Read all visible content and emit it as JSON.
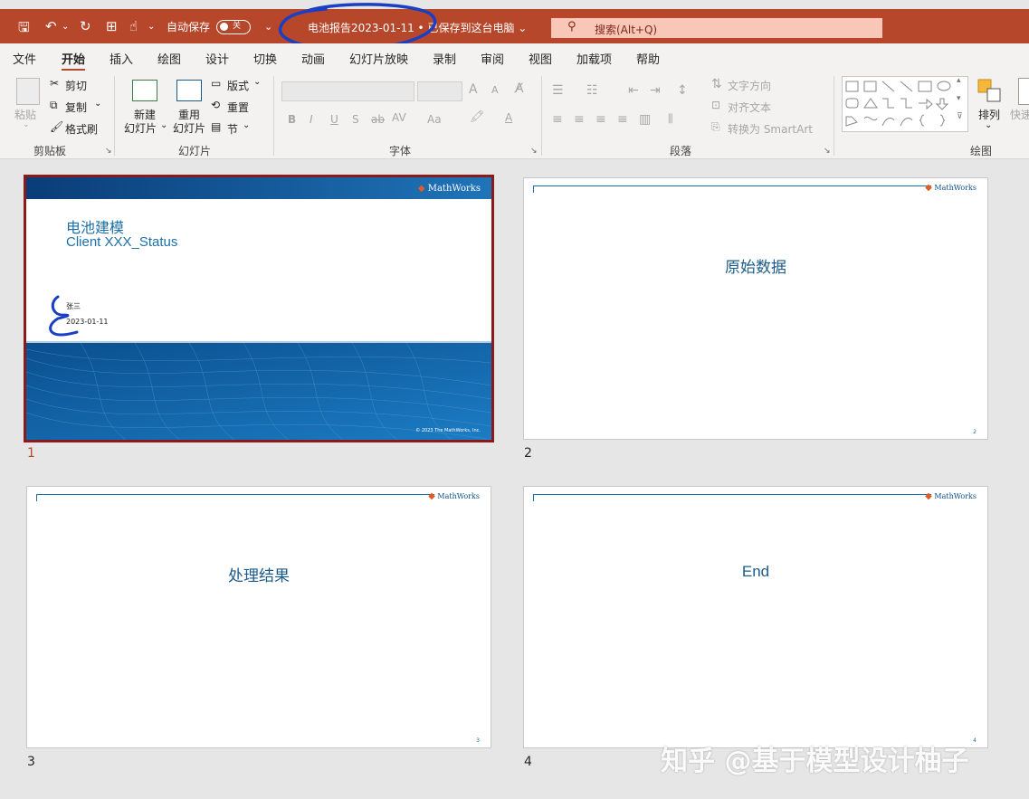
{
  "titlebar": {
    "autosave_label": "自动保存",
    "autosave_state": "关",
    "document_title": "电池报告2023-01-11 • 已保存到这台电脑",
    "search_placeholder": "搜索(Alt+Q)",
    "accent_color": "#b7472a"
  },
  "tabs": [
    {
      "label": "文件"
    },
    {
      "label": "开始",
      "active": true
    },
    {
      "label": "插入"
    },
    {
      "label": "绘图"
    },
    {
      "label": "设计"
    },
    {
      "label": "切换"
    },
    {
      "label": "动画"
    },
    {
      "label": "幻灯片放映"
    },
    {
      "label": "录制"
    },
    {
      "label": "审阅"
    },
    {
      "label": "视图"
    },
    {
      "label": "加载项"
    },
    {
      "label": "帮助"
    }
  ],
  "ribbon": {
    "clipboard": {
      "paste": "粘贴",
      "cut": "剪切",
      "copy": "复制",
      "format_painter": "格式刷",
      "label": "剪贴板"
    },
    "slides": {
      "new_1": "新建",
      "new_2": "幻灯片",
      "reuse_1": "重用",
      "reuse_2": "幻灯片",
      "layout": "版式",
      "reset": "重置",
      "section": "节",
      "label": "幻灯片"
    },
    "font": {
      "label": "字体",
      "bold": "B",
      "italic": "I",
      "underline": "U",
      "shadow": "S",
      "strike": "ab",
      "spacing": "AV",
      "case": "Aa",
      "grow": "A",
      "shrink": "A",
      "font_color": "A"
    },
    "paragraph": {
      "label": "段落",
      "text_direction": "文字方向",
      "align_text": "对齐文本",
      "smartart": "转换为 SmartArt"
    },
    "drawing": {
      "arrange": "排列",
      "quick": "快速",
      "label": "绘图"
    }
  },
  "slides": [
    {
      "num": "1",
      "selected": true,
      "title_line1": "电池建模",
      "title_line2": "Client XXX_Status",
      "author": "张三",
      "date": "2023-01-11",
      "copyright": "© 2023 The MathWorks, Inc.",
      "logo": "MathWorks"
    },
    {
      "num": "2",
      "title": "原始数据",
      "page": "2",
      "logo": "MathWorks"
    },
    {
      "num": "3",
      "title": "处理结果",
      "page": "3",
      "logo": "MathWorks"
    },
    {
      "num": "4",
      "title": "End",
      "page": "4",
      "logo": "MathWorks"
    }
  ],
  "watermark": "知乎 @基于模型设计柚子"
}
